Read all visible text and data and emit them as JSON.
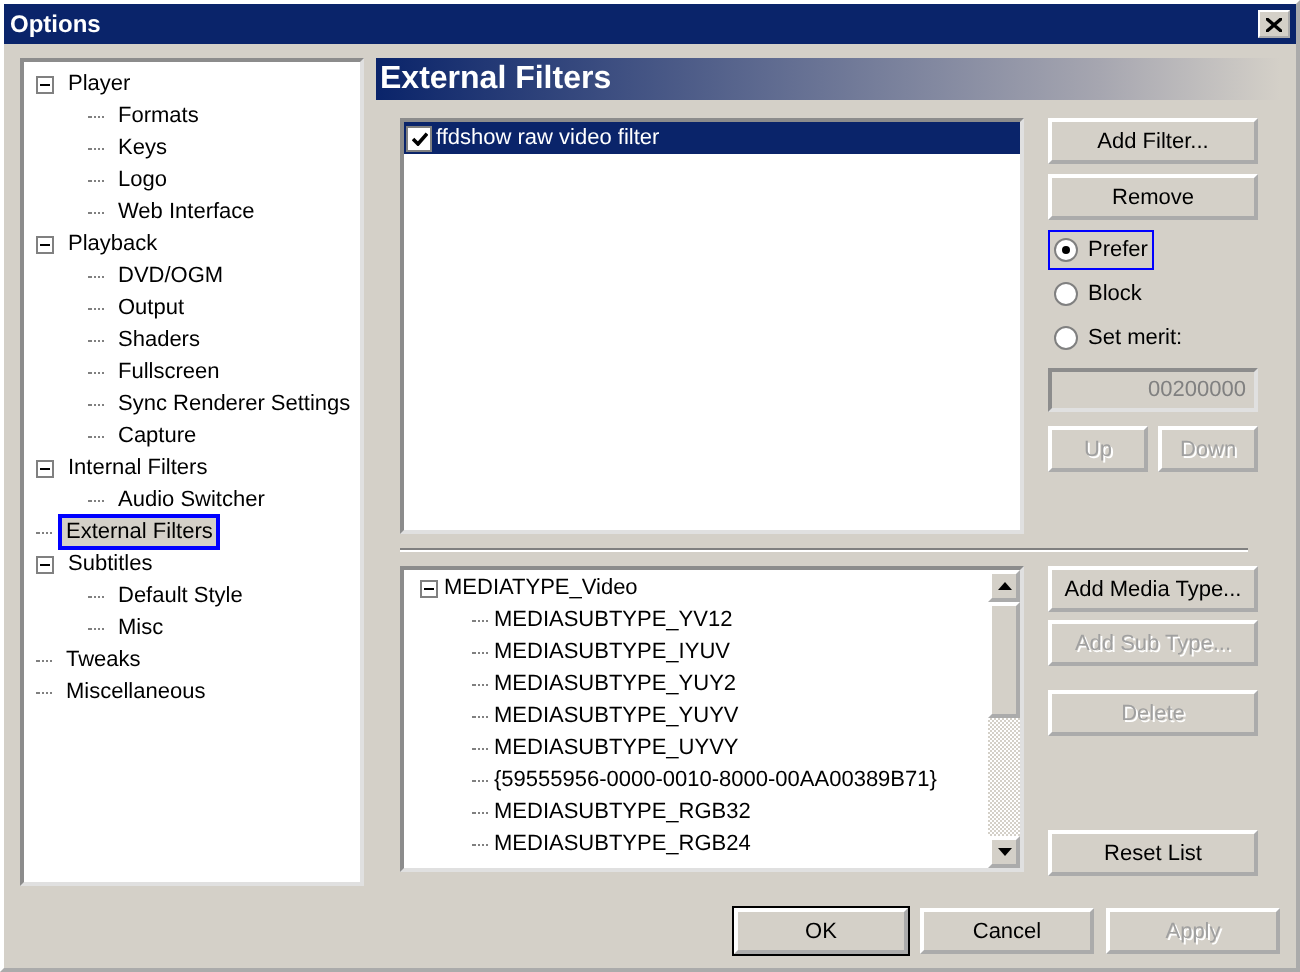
{
  "window": {
    "title": "Options"
  },
  "sidebar": {
    "items": [
      {
        "label": "Player",
        "selected": false,
        "expanded": true,
        "children": [
          {
            "label": "Formats",
            "selected": false
          },
          {
            "label": "Keys",
            "selected": false
          },
          {
            "label": "Logo",
            "selected": false
          },
          {
            "label": "Web Interface",
            "selected": false
          }
        ]
      },
      {
        "label": "Playback",
        "selected": false,
        "expanded": true,
        "children": [
          {
            "label": "DVD/OGM",
            "selected": false
          },
          {
            "label": "Output",
            "selected": false
          },
          {
            "label": "Shaders",
            "selected": false
          },
          {
            "label": "Fullscreen",
            "selected": false
          },
          {
            "label": "Sync Renderer Settings",
            "selected": false
          },
          {
            "label": "Capture",
            "selected": false
          }
        ]
      },
      {
        "label": "Internal Filters",
        "selected": false,
        "expanded": true,
        "children": [
          {
            "label": "Audio Switcher",
            "selected": false
          }
        ]
      },
      {
        "label": "External Filters",
        "selected": true
      },
      {
        "label": "Subtitles",
        "selected": false,
        "expanded": true,
        "children": [
          {
            "label": "Default Style",
            "selected": false
          },
          {
            "label": "Misc",
            "selected": false
          }
        ]
      },
      {
        "label": "Tweaks",
        "selected": false
      },
      {
        "label": "Miscellaneous",
        "selected": false
      }
    ]
  },
  "page": {
    "title": "External Filters"
  },
  "filters": {
    "items": [
      {
        "label": "ffdshow raw video filter",
        "checked": true,
        "selected": true
      }
    ]
  },
  "filter_buttons": [
    {
      "label": "Add Filter...",
      "disabled": false
    },
    {
      "label": "Remove",
      "disabled": false
    }
  ],
  "merit_options": [
    {
      "label": "Prefer",
      "selected": true
    },
    {
      "label": "Block",
      "selected": false
    },
    {
      "label": "Set merit:",
      "selected": false
    }
  ],
  "merit_field": {
    "value": "00200000",
    "disabled": true
  },
  "order_buttons": [
    {
      "label": "Up",
      "disabled": true
    },
    {
      "label": "Down",
      "disabled": true
    }
  ],
  "media_types": {
    "items": [
      {
        "label": "MEDIATYPE_Video",
        "expanded": true,
        "children": [
          {
            "label": "MEDIASUBTYPE_YV12"
          },
          {
            "label": "MEDIASUBTYPE_IYUV"
          },
          {
            "label": "MEDIASUBTYPE_YUY2"
          },
          {
            "label": "MEDIASUBTYPE_YUYV"
          },
          {
            "label": "MEDIASUBTYPE_UYVY"
          },
          {
            "label": "{59555956-0000-0010-8000-00AA00389B71}"
          },
          {
            "label": "MEDIASUBTYPE_RGB32"
          },
          {
            "label": "MEDIASUBTYPE_RGB24"
          }
        ]
      }
    ]
  },
  "media_buttons": [
    {
      "label": "Add Media Type...",
      "disabled": false
    },
    {
      "label": "Add Sub Type...",
      "disabled": true
    },
    {
      "label": "Delete",
      "disabled": true
    },
    {
      "label": "Reset List",
      "disabled": false
    }
  ],
  "dialog_buttons": [
    {
      "label": "OK",
      "disabled": false,
      "default": true
    },
    {
      "label": "Cancel",
      "disabled": false,
      "default": false
    },
    {
      "label": "Apply",
      "disabled": true,
      "default": false
    }
  ]
}
